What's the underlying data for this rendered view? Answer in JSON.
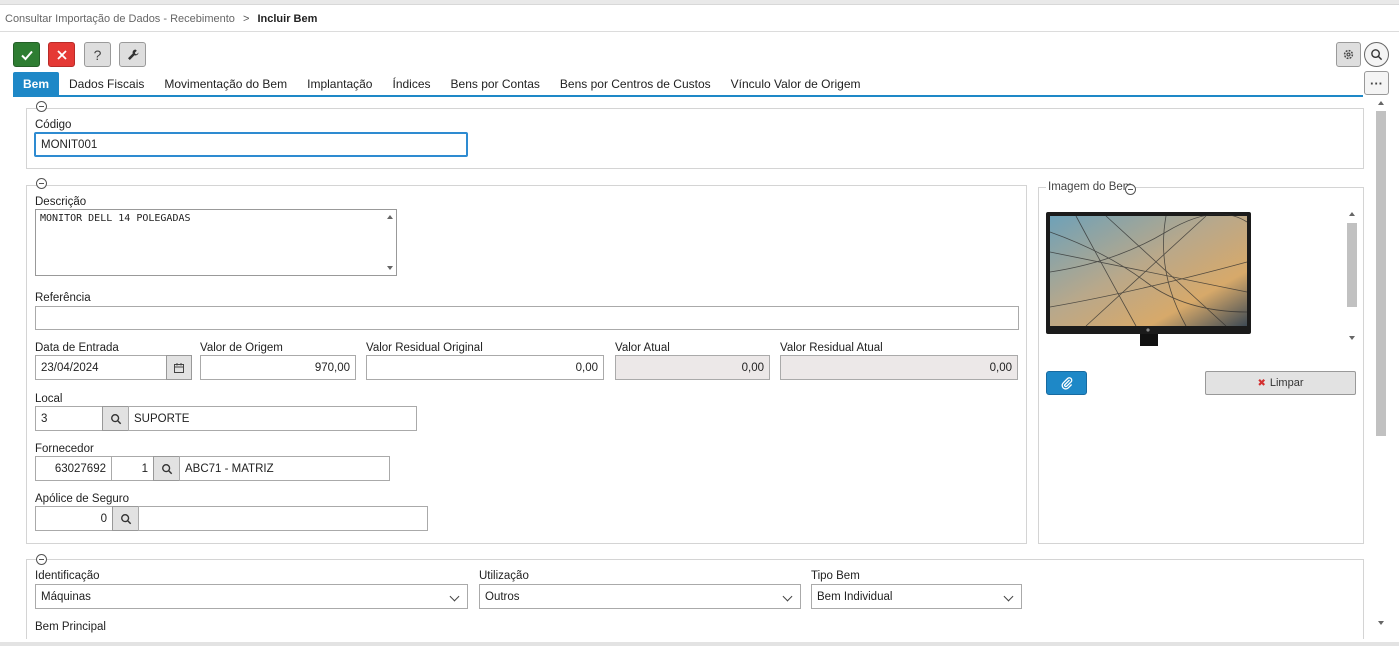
{
  "breadcrumb": {
    "parent": "Consultar Importação de Dados - Recebimento",
    "separator": ">",
    "current": "Incluir Bem"
  },
  "toolbar": {
    "confirm_icon": "check-icon",
    "cancel_icon": "close-icon",
    "help_label": "?",
    "tools_icon": "wrench-icon"
  },
  "tabs": [
    {
      "label": "Bem",
      "active": true
    },
    {
      "label": "Dados Fiscais"
    },
    {
      "label": "Movimentação do Bem"
    },
    {
      "label": "Implantação"
    },
    {
      "label": "Índices"
    },
    {
      "label": "Bens por Contas"
    },
    {
      "label": "Bens por Centros de Custos"
    },
    {
      "label": "Vínculo Valor de Origem"
    }
  ],
  "more_label": "···",
  "codigo": {
    "label": "Código",
    "value": "MONIT001"
  },
  "descricao": {
    "label": "Descrição",
    "value": "MONITOR DELL 14 POLEGADAS"
  },
  "referencia": {
    "label": "Referência",
    "value": ""
  },
  "data_entrada": {
    "label": "Data de Entrada",
    "value": "23/04/2024"
  },
  "valor_origem": {
    "label": "Valor de Origem",
    "value": "970,00"
  },
  "valor_residual_original": {
    "label": "Valor Residual Original",
    "value": "0,00"
  },
  "valor_atual": {
    "label": "Valor Atual",
    "value": "0,00"
  },
  "valor_residual_atual": {
    "label": "Valor Residual Atual",
    "value": "0,00"
  },
  "local": {
    "label": "Local",
    "code": "3",
    "name": "SUPORTE"
  },
  "fornecedor": {
    "label": "Fornecedor",
    "code": "63027692",
    "store": "1",
    "name": "ABC71 - MATRIZ"
  },
  "apolice": {
    "label": "Apólice de Seguro",
    "value": "0",
    "name": ""
  },
  "imagem": {
    "title": "Imagem do Bem",
    "clear_label": "Limpar",
    "attach_icon": "paperclip-icon"
  },
  "identificacao": {
    "label": "Identificação",
    "value": "Máquinas"
  },
  "utilizacao": {
    "label": "Utilização",
    "value": "Outros"
  },
  "tipo_bem": {
    "label": "Tipo Bem",
    "value": "Bem Individual"
  },
  "bem_principal": {
    "label": "Bem Principal"
  },
  "colors": {
    "accent": "#1e88c7",
    "confirm": "#2e7d32",
    "cancel": "#e53935",
    "readonly": "#ece8e8"
  }
}
